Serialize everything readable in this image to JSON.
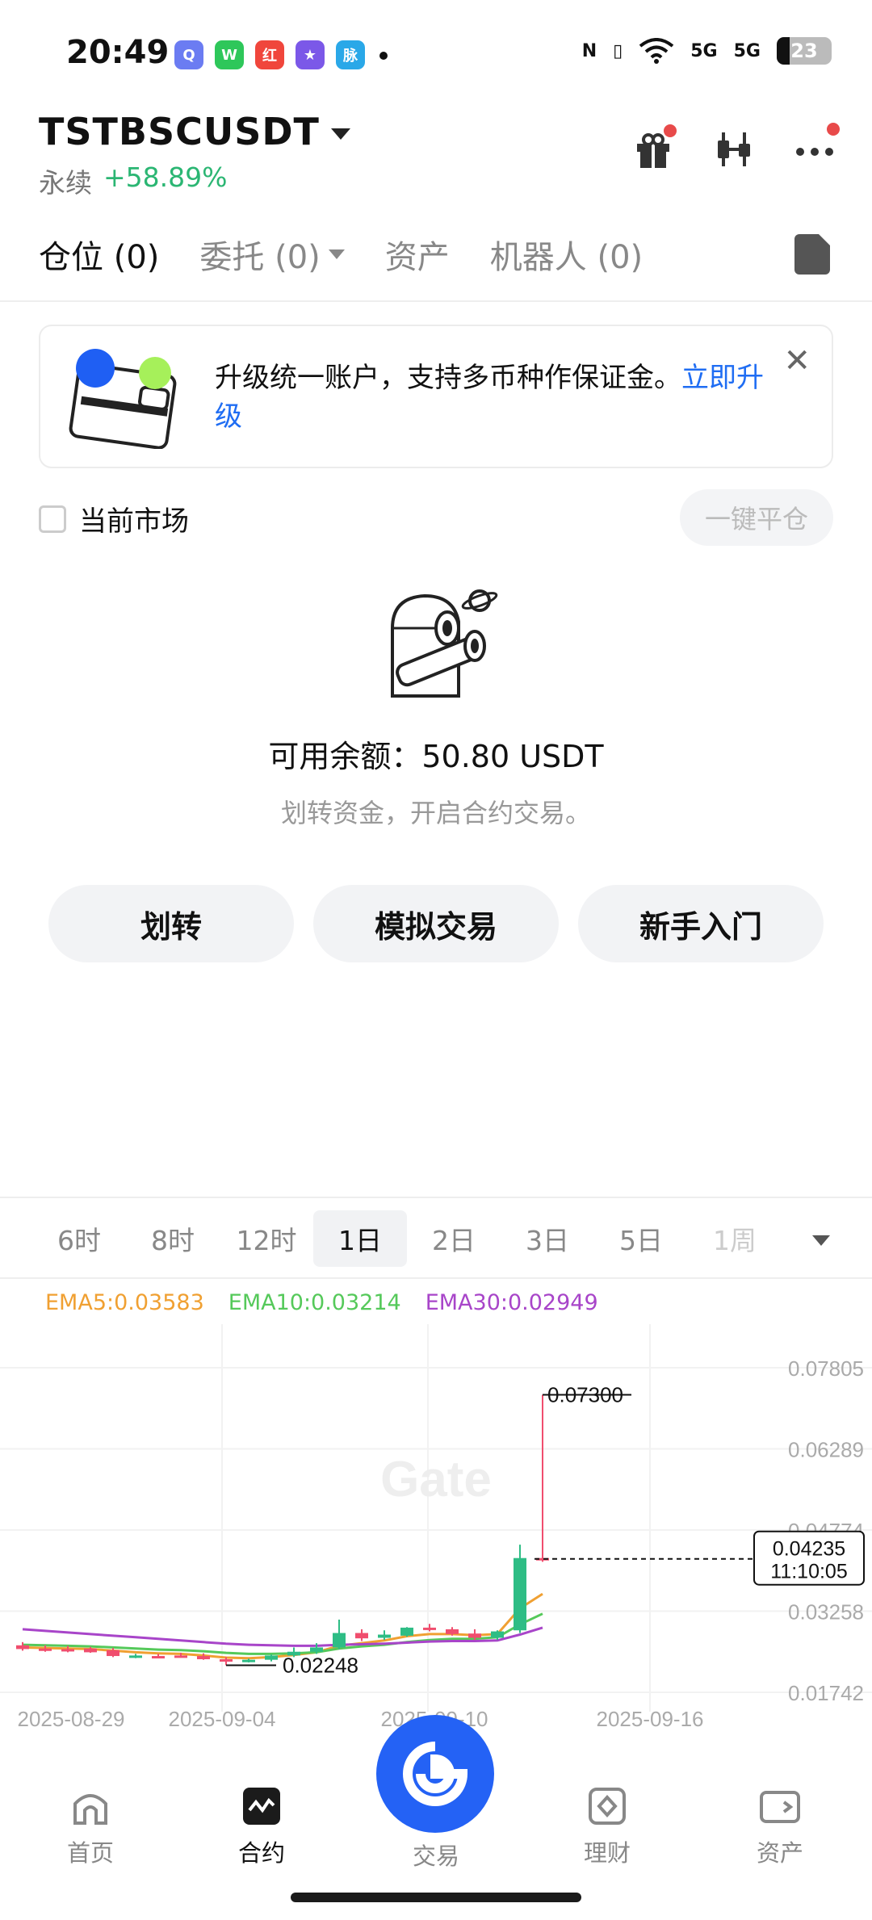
{
  "status_bar": {
    "time": "20:49",
    "battery": "23",
    "signal_1": "5G",
    "signal_2": "5G"
  },
  "header": {
    "pair": "TSTBSCUSDT",
    "contract_kind": "永续",
    "change": "+58.89%"
  },
  "tabs": [
    {
      "label": "仓位 (0)"
    },
    {
      "label": "委托 (0)"
    },
    {
      "label": "资产"
    },
    {
      "label": "机器人 (0)"
    }
  ],
  "banner": {
    "text": "升级统一账户，支持多币种作保证金。",
    "link": "立即升级"
  },
  "market_filter": {
    "label": "当前市场",
    "close_all": "一键平仓"
  },
  "empty_state": {
    "balance": "可用余额：50.80 USDT",
    "hint": "划转资金，开启合约交易。"
  },
  "actions": [
    {
      "label": "划转"
    },
    {
      "label": "模拟交易"
    },
    {
      "label": "新手入门"
    }
  ],
  "timeframes": [
    "6时",
    "8时",
    "12时",
    "1日",
    "2日",
    "3日",
    "5日",
    "1周"
  ],
  "active_timeframe": "1日",
  "ema": {
    "ema5": "EMA5:0.03583",
    "ema10": "EMA10:0.03214",
    "ema30": "EMA30:0.02949"
  },
  "chart_data": {
    "type": "candlestick",
    "watermark": "Gate",
    "y_ticks": [
      "0.07805",
      "0.06289",
      "0.04774",
      "0.03258",
      "0.01742"
    ],
    "x_ticks": [
      "2025-08-29",
      "2025-09-04",
      "2025-09-10",
      "2025-09-16"
    ],
    "ylim": [
      0.01742,
      0.07805
    ],
    "high_label": "0.07300",
    "low_label": "0.02248",
    "last_price": "0.04235",
    "countdown": "11:10:05",
    "up_color": "#2ebd85",
    "down_color": "#f04e6e",
    "candles": [
      {
        "o": 0.0262,
        "h": 0.0268,
        "l": 0.0252,
        "c": 0.0255
      },
      {
        "o": 0.0256,
        "h": 0.0262,
        "l": 0.025,
        "c": 0.0254
      },
      {
        "o": 0.0255,
        "h": 0.0261,
        "l": 0.0249,
        "c": 0.0252
      },
      {
        "o": 0.0256,
        "h": 0.0259,
        "l": 0.0248,
        "c": 0.0249
      },
      {
        "o": 0.0253,
        "h": 0.0257,
        "l": 0.024,
        "c": 0.0242
      },
      {
        "o": 0.0241,
        "h": 0.0246,
        "l": 0.0238,
        "c": 0.0243
      },
      {
        "o": 0.0242,
        "h": 0.0246,
        "l": 0.0238,
        "c": 0.0241
      },
      {
        "o": 0.0243,
        "h": 0.0248,
        "l": 0.024,
        "c": 0.0242
      },
      {
        "o": 0.0242,
        "h": 0.0247,
        "l": 0.0235,
        "c": 0.0236
      },
      {
        "o": 0.0236,
        "h": 0.024,
        "l": 0.02248,
        "c": 0.0232
      },
      {
        "o": 0.0233,
        "h": 0.0237,
        "l": 0.023,
        "c": 0.0235
      },
      {
        "o": 0.0235,
        "h": 0.0245,
        "l": 0.0232,
        "c": 0.0243
      },
      {
        "o": 0.0243,
        "h": 0.0258,
        "l": 0.024,
        "c": 0.025
      },
      {
        "o": 0.025,
        "h": 0.0266,
        "l": 0.0246,
        "c": 0.0258
      },
      {
        "o": 0.0258,
        "h": 0.031,
        "l": 0.0255,
        "c": 0.0285
      },
      {
        "o": 0.0285,
        "h": 0.0292,
        "l": 0.027,
        "c": 0.0275
      },
      {
        "o": 0.0276,
        "h": 0.029,
        "l": 0.0272,
        "c": 0.0282
      },
      {
        "o": 0.028,
        "h": 0.0296,
        "l": 0.0278,
        "c": 0.0295
      },
      {
        "o": 0.0295,
        "h": 0.0302,
        "l": 0.0288,
        "c": 0.0291
      },
      {
        "o": 0.0292,
        "h": 0.0296,
        "l": 0.028,
        "c": 0.0283
      },
      {
        "o": 0.0284,
        "h": 0.0292,
        "l": 0.0272,
        "c": 0.0276
      },
      {
        "o": 0.0276,
        "h": 0.029,
        "l": 0.0272,
        "c": 0.0288
      },
      {
        "o": 0.029,
        "h": 0.045,
        "l": 0.0285,
        "c": 0.0425
      },
      {
        "o": 0.0425,
        "h": 0.073,
        "l": 0.0418,
        "c": 0.04235
      }
    ],
    "ema_lines": [
      {
        "name": "EMA5",
        "color": "#f0a032",
        "values": [
          0.0258,
          0.0257,
          0.0256,
          0.0255,
          0.0252,
          0.0249,
          0.0247,
          0.0246,
          0.0243,
          0.0239,
          0.0238,
          0.024,
          0.0244,
          0.0249,
          0.0261,
          0.0266,
          0.0271,
          0.0279,
          0.0283,
          0.0283,
          0.0281,
          0.0283,
          0.0331,
          0.0358
        ]
      },
      {
        "name": "EMA10",
        "color": "#55c95a",
        "values": [
          0.0263,
          0.0262,
          0.0261,
          0.026,
          0.0258,
          0.0256,
          0.0254,
          0.0253,
          0.0251,
          0.0248,
          0.0246,
          0.0246,
          0.0247,
          0.0249,
          0.0256,
          0.026,
          0.0263,
          0.0268,
          0.0272,
          0.0274,
          0.0274,
          0.0277,
          0.0301,
          0.0321
        ]
      },
      {
        "name": "EMA30",
        "color": "#a845c9",
        "values": [
          0.0292,
          0.0289,
          0.0286,
          0.0283,
          0.028,
          0.0277,
          0.0274,
          0.0271,
          0.0268,
          0.0265,
          0.0263,
          0.0262,
          0.0261,
          0.0261,
          0.0263,
          0.0264,
          0.0265,
          0.0267,
          0.0269,
          0.027,
          0.027,
          0.0271,
          0.0282,
          0.0295
        ]
      }
    ]
  },
  "bottom_nav": [
    {
      "label": "首页"
    },
    {
      "label": "合约"
    },
    {
      "label": "交易"
    },
    {
      "label": "理财"
    },
    {
      "label": "资产"
    }
  ]
}
